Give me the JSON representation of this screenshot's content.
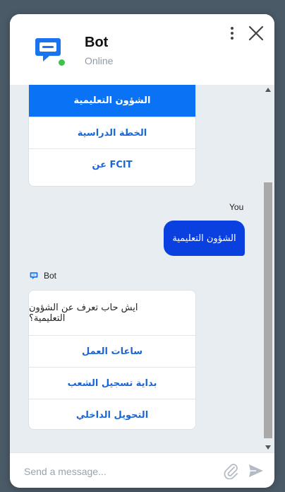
{
  "header": {
    "bot_name": "Bot",
    "status": "Online",
    "icons": {
      "avatar": "chat-bubble-icon",
      "menu": "more-vertical-icon",
      "close": "close-icon"
    }
  },
  "colors": {
    "accent": "#0a72f5",
    "user_bubble": "#0b40e0",
    "online": "#3cc44a",
    "link": "#1a66d6"
  },
  "messages": {
    "card1_options": [
      "الشؤون التعليمية",
      "الخطة الدراسية",
      "عن FCIT"
    ],
    "card1_selected_index": 0,
    "you_label": "You",
    "user_message": "الشؤون التعليمية",
    "bot_label": "Bot",
    "bot_question": "ايش حاب تعرف عن الشؤون التعليمية؟",
    "card2_options": [
      "ساعات العمل",
      "بداية تسجيل الشعب",
      "التحويل الداخلي"
    ]
  },
  "composer": {
    "placeholder": "Send a message...",
    "icons": {
      "attach": "paperclip-icon",
      "send": "send-icon"
    }
  }
}
